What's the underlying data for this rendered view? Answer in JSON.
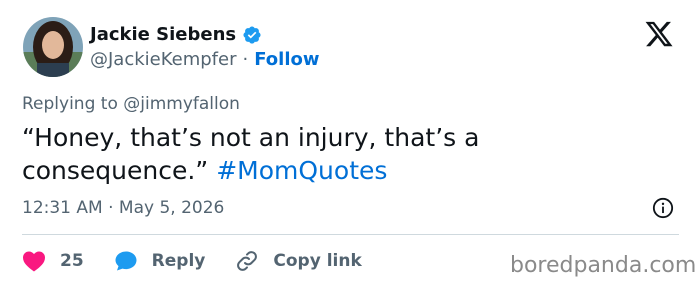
{
  "author": {
    "name": "Jackie Siebens",
    "handle": "@JackieKempfer",
    "separator": "·",
    "follow_label": "Follow",
    "verified_color": "#1d9bf0"
  },
  "reply_context": {
    "prefix": "Replying to",
    "mention": "@jimmyfallon"
  },
  "tweet": {
    "text": "“Honey, that’s not an injury, that’s a consequence.”",
    "hashtag": "#MomQuotes",
    "time": "12:31 AM",
    "date_separator": "·",
    "date": "May 5, 2026"
  },
  "actions": {
    "like_count": "25",
    "reply_label": "Reply",
    "copy_link_label": "Copy link"
  },
  "colors": {
    "link_blue": "#006fd6",
    "like_red": "#f91880",
    "secondary_text": "#536471"
  },
  "icons": [
    "verified-badge-icon",
    "x-logo-icon",
    "info-icon",
    "heart-icon",
    "reply-bubble-icon",
    "link-icon"
  ],
  "watermark": "boredpanda.com"
}
